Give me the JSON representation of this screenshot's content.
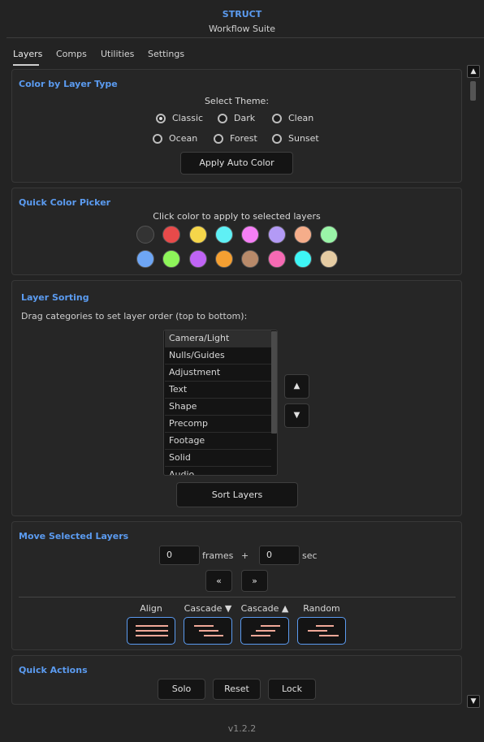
{
  "header": {
    "brand": "STRUCT",
    "subtitle": "Workflow Suite"
  },
  "tabs": [
    {
      "label": "Layers",
      "active": true
    },
    {
      "label": "Comps",
      "active": false
    },
    {
      "label": "Utilities",
      "active": false
    },
    {
      "label": "Settings",
      "active": false
    }
  ],
  "color_by_type": {
    "title": "Color by Layer Type",
    "theme_label": "Select Theme:",
    "themes": [
      {
        "label": "Classic",
        "checked": true
      },
      {
        "label": "Dark",
        "checked": false
      },
      {
        "label": "Clean",
        "checked": false
      },
      {
        "label": "Ocean",
        "checked": false
      },
      {
        "label": "Forest",
        "checked": false
      },
      {
        "label": "Sunset",
        "checked": false
      }
    ],
    "apply_label": "Apply Auto Color"
  },
  "quick_color": {
    "title": "Quick Color Picker",
    "hint": "Click color to apply to selected layers",
    "colors": [
      "#333333",
      "#e84a4a",
      "#f5d64a",
      "#5ff0f5",
      "#f57ff5",
      "#b39af5",
      "#f5ad8a",
      "#9af5a8",
      "#6ea6f5",
      "#8ef55a",
      "#c064f5",
      "#f5a032",
      "#b88a6a",
      "#f56ab3",
      "#3ef5f5",
      "#e6cca3"
    ]
  },
  "sorting": {
    "title": "Layer Sorting",
    "hint": "Drag categories to set layer order (top to bottom):",
    "items": [
      "Camera/Light",
      "Nulls/Guides",
      "Adjustment",
      "Text",
      "Shape",
      "Precomp",
      "Footage",
      "Solid",
      "Audio"
    ],
    "up_icon": "▲",
    "down_icon": "▼",
    "sort_label": "Sort Layers"
  },
  "move": {
    "title": "Move Selected Layers",
    "frames_value": "0",
    "frames_label": "frames",
    "plus": "+",
    "sec_value": "0",
    "sec_label": "sec",
    "back_label": "«",
    "forward_label": "»",
    "modes": [
      "Align",
      "Cascade ▼",
      "Cascade ▲",
      "Random"
    ]
  },
  "quick_actions": {
    "title": "Quick Actions",
    "buttons": [
      "Solo",
      "Reset",
      "Lock"
    ]
  },
  "scroll": {
    "up": "▲",
    "down": "▼"
  },
  "version": "v1.2.2"
}
